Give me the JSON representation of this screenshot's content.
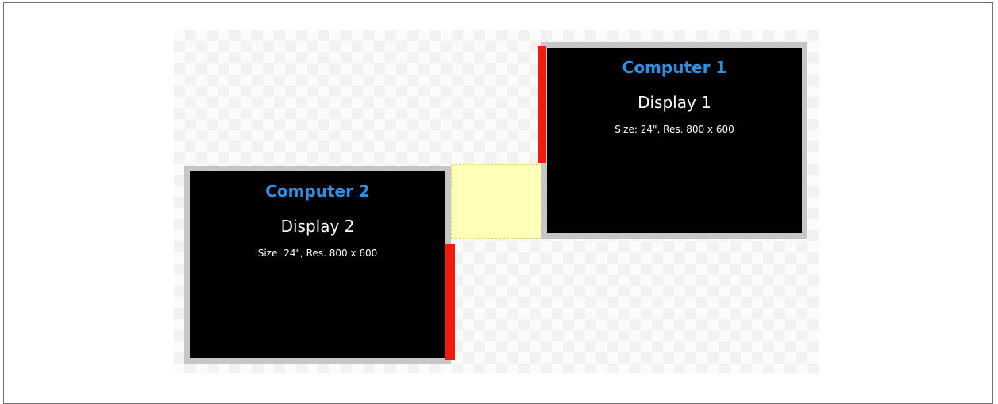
{
  "layout_canvas": {
    "displays": [
      {
        "computer": "Computer 1",
        "display": "Display 1",
        "spec": "Size: 24\", Res. 800 x 600",
        "accent_color": "#2f8fe0",
        "edge_color": "#ef1c0c"
      },
      {
        "computer": "Computer 2",
        "display": "Display 2",
        "spec": "Size: 24\", Res. 800 x 600",
        "accent_color": "#2f8fe0",
        "edge_color": "#ef1c0c"
      }
    ],
    "link_zone_color": "#ffffb8"
  }
}
